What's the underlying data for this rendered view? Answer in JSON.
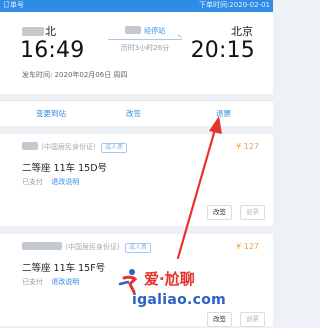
{
  "status_bar": {
    "order_label": "订单号",
    "order_time": "下单时间:2020-02-01"
  },
  "trip": {
    "from_station": "北",
    "to_station": "北京",
    "train_link": "经停站",
    "duration": "历时3小时26分",
    "dep_time": "16:49",
    "arr_time": "20:15",
    "depart_info": "发车时间: 2020年02月06日 周四"
  },
  "actions": {
    "change_station": "变更到站",
    "reschedule": "改签",
    "refund": "退票"
  },
  "passengers": [
    {
      "id_type": "(中国居民身份证)",
      "tag": "成人票",
      "price": "¥ 127",
      "seat": "二等座 11车 15D号",
      "paid": "已支付",
      "refund_policy": "退改说明",
      "sign_btn": "改签",
      "refund_btn": "退票"
    },
    {
      "id_type": "(中国居民身份证)",
      "tag": "成人票",
      "price": "¥ 127",
      "seat": "二等座 11车 15F号",
      "paid": "已支付",
      "refund_policy": "退改说明",
      "sign_btn": "改签",
      "refund_btn": "退票"
    }
  ],
  "watermark": {
    "text": "爱·尬聊",
    "url": "igaliao.com"
  },
  "colors": {
    "primary": "#2f8ce6",
    "price": "#f0a142",
    "arrow": "#e8322e"
  }
}
